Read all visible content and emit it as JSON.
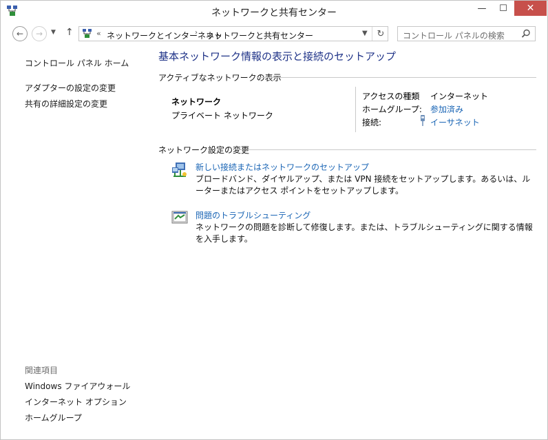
{
  "window": {
    "title": "ネットワークと共有センター"
  },
  "titlebar": {
    "minimize": "—",
    "maximize": "☐",
    "close": "✕"
  },
  "nav": {
    "recent": "▼",
    "up": "↑",
    "address_prefix": "«",
    "breadcrumbs": [
      "ネットワークとインターネット",
      "ネットワークと共有センター"
    ],
    "separator": "›",
    "search_placeholder": "コントロール パネルの検索"
  },
  "sidebar": {
    "home": "コントロール パネル ホーム",
    "links": [
      "アダプターの設定の変更",
      "共有の詳細設定の変更"
    ],
    "related_heading": "関連項目",
    "related": [
      "Windows ファイアウォール",
      "インターネット オプション",
      "ホームグループ"
    ]
  },
  "main": {
    "title": "基本ネットワーク情報の表示と接続のセットアップ",
    "active_heading": "アクティブなネットワークの表示",
    "network": {
      "name": "ネットワーク",
      "category": "プライベート ネットワーク",
      "access_type_label": "アクセスの種類",
      "access_type": "インターネット",
      "homegroup_label": "ホームグループ:",
      "homegroup": "参加済み",
      "connection_label": "接続:",
      "connection": "イーサネット"
    },
    "change_heading": "ネットワーク設定の変更",
    "tasks": [
      {
        "title": "新しい接続またはネットワークのセットアップ",
        "desc": "ブロードバンド、ダイヤルアップ、または VPN 接続をセットアップします。あるいは、ルーターまたはアクセス ポイントをセットアップします。",
        "icon": "network-setup-icon"
      },
      {
        "title": "問題のトラブルシューティング",
        "desc": "ネットワークの問題を診断して修復します。または、トラブルシューティングに関する情報を入手します。",
        "icon": "troubleshoot-icon"
      }
    ]
  },
  "colors": {
    "link": "#1a65b5",
    "title": "#1e3287",
    "close_button": "#c7504b"
  }
}
